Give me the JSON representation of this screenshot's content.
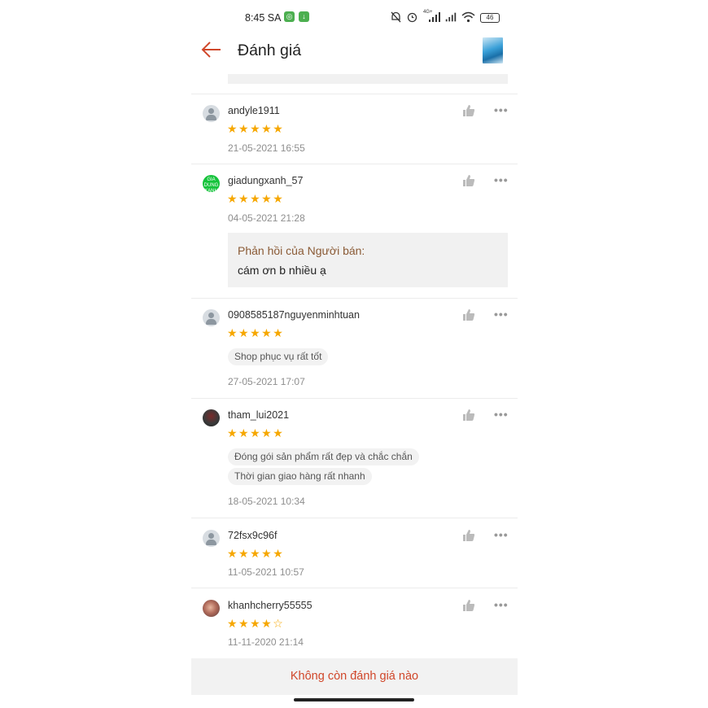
{
  "status_bar": {
    "time": "8:45 SA",
    "network": "4G+",
    "battery": "46"
  },
  "header": {
    "title": "Đánh giá"
  },
  "reviews": [
    {
      "username": "andyle1911",
      "stars": "★★★★★",
      "date": "21-05-2021 16:55",
      "avatar": "default-avatar-icon"
    },
    {
      "username": "giadungxanh_57",
      "stars": "★★★★★",
      "date": "04-05-2021 21:28",
      "avatar_text": "GIA DUNG XANH",
      "reply": {
        "title": "Phản hồi của Người bán:",
        "text": "cám ơn b nhiều ạ"
      }
    },
    {
      "username": "0908585187nguyenminhtuan",
      "stars": "★★★★★",
      "tags": [
        "Shop phục vụ rất tốt"
      ],
      "date": "27-05-2021 17:07"
    },
    {
      "username": "tham_lui2021",
      "stars": "★★★★★",
      "tags": [
        "Đóng gói sản phẩm rất đẹp và chắc chắn",
        "Thời gian giao hàng rất nhanh"
      ],
      "date": "18-05-2021 10:34"
    },
    {
      "username": "72fsx9c96f",
      "stars": "★★★★★",
      "date": "11-05-2021 10:57"
    },
    {
      "username": "khanhcherry55555",
      "stars": "★★★★",
      "stars_empty": "☆",
      "date": "11-11-2020 21:14"
    }
  ],
  "more_icon": "•••",
  "footer": {
    "text": "Không còn đánh giá nào"
  },
  "colors": {
    "accent": "#d0472a",
    "star": "#f6a700",
    "reply_title": "#8a5a35"
  }
}
